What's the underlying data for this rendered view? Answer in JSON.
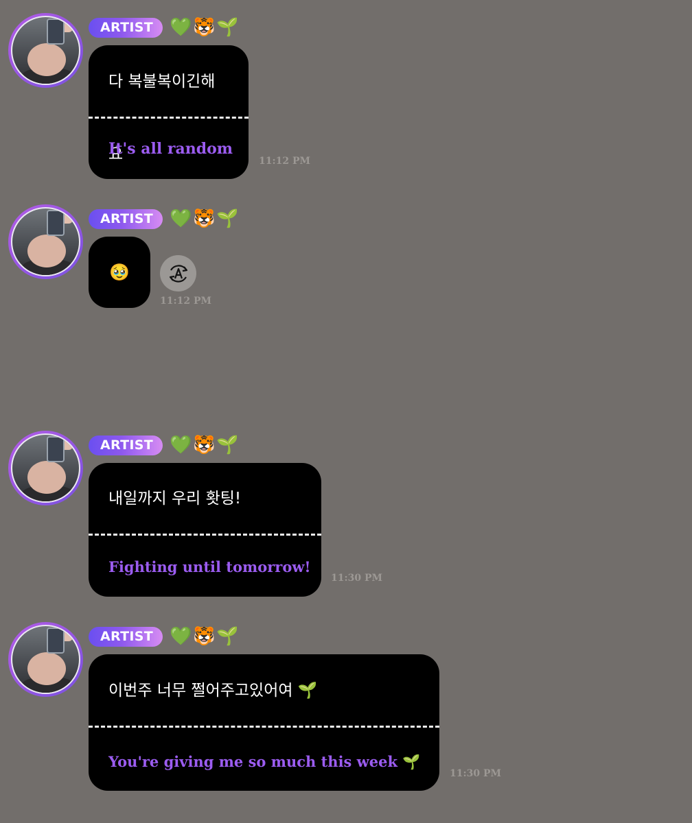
{
  "messages": [
    {
      "badge": "ARTIST",
      "emojis": [
        "💚",
        "🐯",
        "🌱"
      ],
      "korean": "다 복불복이긴해요",
      "english": "It's all random",
      "time": "11:12 PM"
    },
    {
      "badge": "ARTIST",
      "emojis": [
        "💚",
        "🐯",
        "🌱"
      ],
      "emoji_body": "🥹",
      "time": "11:12 PM",
      "translate_icon": "translate-icon"
    },
    {
      "badge": "ARTIST",
      "emojis": [
        "💚",
        "🐯",
        "🌱"
      ],
      "korean": "내일까지 우리 홧팅!",
      "english": "Fighting until tomorrow!",
      "time": "11:30 PM"
    },
    {
      "badge": "ARTIST",
      "emojis": [
        "💚",
        "🐯",
        "🌱"
      ],
      "korean": "이번주 너무 쩔어주고있어여 🌱",
      "english": "You're giving me so much this week 🌱",
      "time": "11:30 PM"
    }
  ],
  "colors": {
    "background": "#726e6b",
    "bubble": "#000000",
    "translation_text": "#9b5cf0",
    "badge_gradient_start": "#6a4ff0",
    "badge_gradient_end": "#d78cf3"
  }
}
